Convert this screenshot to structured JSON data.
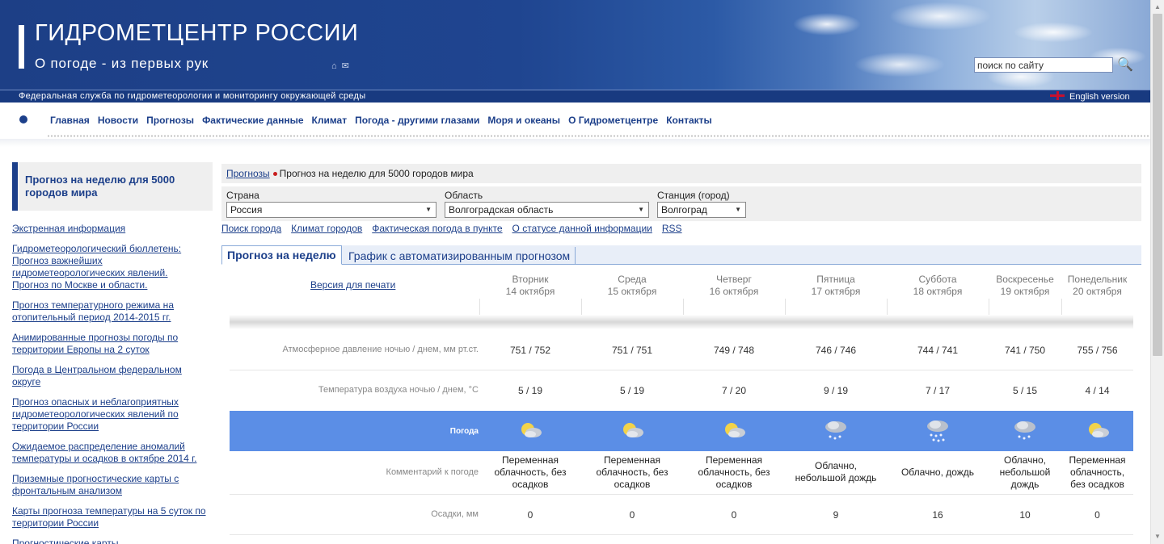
{
  "header": {
    "title": "ГИДРОМЕТЦЕНТР РОССИИ",
    "subtitle": "О погоде - из первых рук",
    "icons": [
      "home-icon",
      "mail-icon"
    ],
    "search_placeholder": "поиск по сайту",
    "federal_service": "Федеральная служба по гидрометеорологии и мониторингу окружающей среды",
    "english_version": "English version"
  },
  "nav": {
    "items": [
      "Главная",
      "Новости",
      "Прогнозы",
      "Фактические данные",
      "Климат",
      "Погода - другими глазами",
      "Моря и океаны",
      "О Гидрометцентре",
      "Контакты"
    ]
  },
  "sidebar": {
    "title": "Прогноз на неделю для 5000 городов мира",
    "links": [
      "Экстренная информация",
      "Гидрометеорологический бюллетень: Прогноз важнейших гидрометеорологических явлений. Прогноз по Москве и области.",
      "Прогноз температурного режима на отопительный период 2014-2015 гг.",
      "Анимированные прогнозы погоды по территории Европы на 2 суток",
      "Погода в Центральном федеральном округе",
      "Прогноз опасных и неблагоприятных гидрометеорологических явлений по территории России",
      "Ожидаемое распределение аномалий температуры и осадков в октябре 2014 г.",
      "Приземные прогностические карты с фронтальным анализом",
      "Карты прогноза температуры на 5 суток по территории России",
      "Прогностические карты"
    ]
  },
  "breadcrumb": {
    "parent": "Прогнозы",
    "current": "Прогноз на неделю для 5000 городов мира"
  },
  "filters": {
    "country_label": "Страна",
    "country_value": "Россия",
    "region_label": "Область",
    "region_value": "Волгоградская область",
    "station_label": "Станция (город)",
    "station_value": "Волгоград"
  },
  "sub_links": [
    "Поиск города",
    "Климат городов",
    "Фактическая погода в пункте",
    "О статусе данной информации",
    "RSS"
  ],
  "tabs": [
    "Прогноз на неделю",
    "График с автоматизированным прогнозом"
  ],
  "print_version": "Версия для печати",
  "forecast": {
    "days": [
      {
        "name": "Вторник",
        "date": "14 октября",
        "pressure": "751 / 752",
        "temp": "5 / 19",
        "icon": "partly-cloudy-icon",
        "comment": "Переменная облачность, без осадков",
        "precip": "0"
      },
      {
        "name": "Среда",
        "date": "15 октября",
        "pressure": "751 / 751",
        "temp": "5 / 19",
        "icon": "partly-cloudy-icon",
        "comment": "Переменная облачность, без осадков",
        "precip": "0"
      },
      {
        "name": "Четверг",
        "date": "16 октября",
        "pressure": "749 / 748",
        "temp": "7 / 20",
        "icon": "partly-cloudy-icon",
        "comment": "Переменная облачность, без осадков",
        "precip": "0"
      },
      {
        "name": "Пятница",
        "date": "17 октября",
        "pressure": "746 / 746",
        "temp": "9 / 19",
        "icon": "cloud-rain-icon",
        "comment": "Облачно, небольшой дождь",
        "precip": "9"
      },
      {
        "name": "Суббота",
        "date": "18 октября",
        "pressure": "744 / 741",
        "temp": "7 / 17",
        "icon": "cloud-heavy-rain-icon",
        "comment": "Облачно, дождь",
        "precip": "16"
      },
      {
        "name": "Воскресенье",
        "date": "19 октября",
        "pressure": "741 / 750",
        "temp": "5 / 15",
        "icon": "cloud-rain-icon",
        "comment": "Облачно, небольшой дождь",
        "precip": "10"
      },
      {
        "name": "Понедельник",
        "date": "20 октября",
        "pressure": "755 / 756",
        "temp": "4 / 14",
        "icon": "partly-cloudy-icon",
        "comment": "Переменная облачность, без осадков",
        "precip": "0"
      }
    ],
    "row_labels": {
      "pressure": "Атмосферное давление ночью  /  днем, мм рт.ст.",
      "temp": "Температура воздуха ночью  /  днем, °С",
      "weather": "Погода",
      "comment": "Комментарий к погоде",
      "precip": "Осадки, мм"
    }
  },
  "colors": {
    "brand_blue": "#1c3f8a",
    "weather_row": "#5b8ee6",
    "breadcrumb_dot": "#c81e1e"
  }
}
